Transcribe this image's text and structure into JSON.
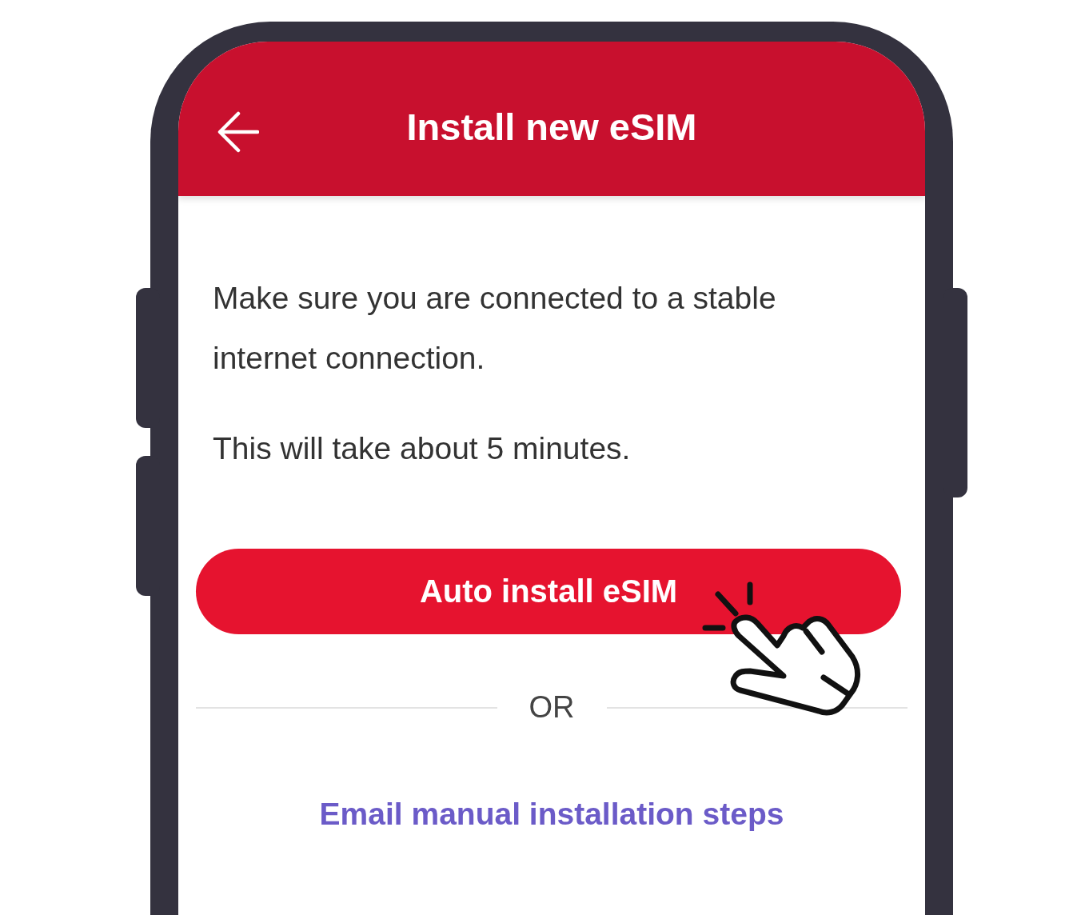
{
  "header": {
    "title": "Install new eSIM"
  },
  "instructions": [
    "Make sure you are connected to a stable internet connection.",
    "This will take about 5 minutes."
  ],
  "primary_button": {
    "label": "Auto install eSIM"
  },
  "divider": {
    "label": "OR"
  },
  "link": {
    "label": "Email manual installation steps"
  }
}
